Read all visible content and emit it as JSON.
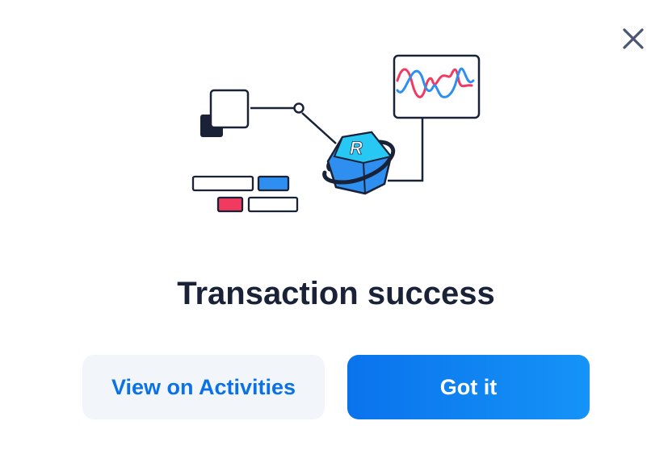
{
  "dialog": {
    "title": "Transaction success",
    "close_icon": "close-icon",
    "illustration_icon_label": "R"
  },
  "actions": {
    "secondary_label": "View on Activities",
    "primary_label": "Got it"
  },
  "colors": {
    "title": "#1a2238",
    "primary_button": "#0a73ec",
    "secondary_button_bg": "#f2f6fb",
    "secondary_button_text": "#0a72e6",
    "accent_red": "#f03a5f",
    "accent_blue": "#2e8ff0"
  }
}
